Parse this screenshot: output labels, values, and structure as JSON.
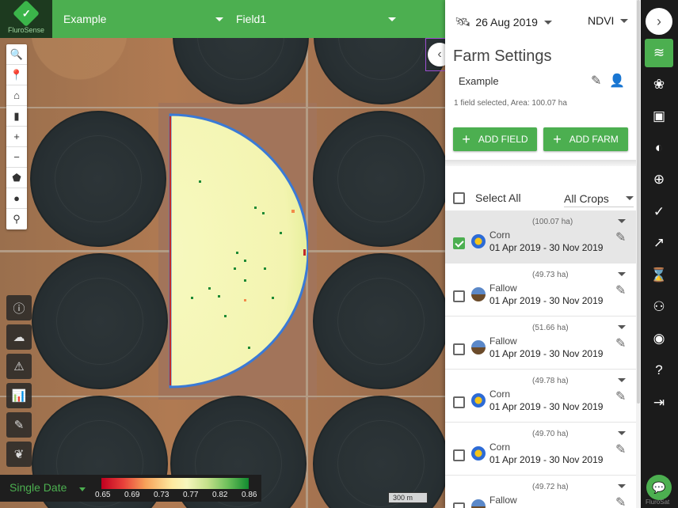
{
  "app": {
    "logo_text": "FluroSense"
  },
  "topbar": {
    "farm_select": "Example",
    "field_select": "Field1"
  },
  "map_tools": [
    {
      "name": "search-icon",
      "glyph": "🔍"
    },
    {
      "name": "pin-icon",
      "glyph": "📍"
    },
    {
      "name": "home-icon",
      "glyph": "⌂"
    },
    {
      "name": "ruler-icon",
      "glyph": "▮"
    },
    {
      "name": "zoom-in-icon",
      "glyph": "+"
    },
    {
      "name": "zoom-out-icon",
      "glyph": "−"
    },
    {
      "name": "polygon-icon",
      "glyph": "⬟"
    },
    {
      "name": "circle-icon",
      "glyph": "●"
    },
    {
      "name": "marker-icon",
      "glyph": "⚲"
    }
  ],
  "left_tools": [
    {
      "name": "info-icon",
      "glyph": "ⓘ"
    },
    {
      "name": "weather-icon",
      "glyph": "☁"
    },
    {
      "name": "warning-icon",
      "glyph": "⚠"
    },
    {
      "name": "chart-icon",
      "glyph": "📊"
    },
    {
      "name": "draw-icon",
      "glyph": "✎"
    },
    {
      "name": "leaf-icon",
      "glyph": "❦"
    }
  ],
  "legend": {
    "mode": "Single Date",
    "ticks": [
      "0.65",
      "0.69",
      "0.73",
      "0.77",
      "0.82",
      "0.86"
    ]
  },
  "scale_label": "300 m",
  "panel": {
    "date": "26 Aug 2019",
    "layer": "NDVI",
    "title": "Farm Settings",
    "farm_name": "Example",
    "selection_info": "1 field selected, Area: 100.07 ha",
    "add_field_label": "ADD FIELD",
    "add_farm_label": "ADD FARM",
    "select_all_label": "Select All",
    "crops_filter": "All Crops",
    "fields": [
      {
        "area": "(100.07 ha)",
        "crop": "Corn",
        "dates": "01 Apr 2019 - 30 Nov 2019",
        "selected": true,
        "crop_type": "corn"
      },
      {
        "area": "(49.73 ha)",
        "crop": "Fallow",
        "dates": "01 Apr 2019 - 30 Nov 2019",
        "selected": false,
        "crop_type": "fallow"
      },
      {
        "area": "(51.66 ha)",
        "crop": "Fallow",
        "dates": "01 Apr 2019 - 30 Nov 2019",
        "selected": false,
        "crop_type": "fallow"
      },
      {
        "area": "(49.78 ha)",
        "crop": "Corn",
        "dates": "01 Apr 2019 - 30 Nov 2019",
        "selected": false,
        "crop_type": "corn"
      },
      {
        "area": "(49.70 ha)",
        "crop": "Corn",
        "dates": "01 Apr 2019 - 30 Nov 2019",
        "selected": false,
        "crop_type": "corn"
      },
      {
        "area": "(49.72 ha)",
        "crop": "Fallow",
        "dates": "",
        "selected": false,
        "crop_type": "fallow"
      }
    ]
  },
  "rail": {
    "icons": [
      {
        "name": "map-layers-icon",
        "glyph": "≋",
        "active": true
      },
      {
        "name": "crop-icon",
        "glyph": "❀"
      },
      {
        "name": "images-icon",
        "glyph": "▣"
      },
      {
        "name": "half-circle-icon",
        "glyph": "◐"
      },
      {
        "name": "zones-icon",
        "glyph": "⊕"
      },
      {
        "name": "check-circle-icon",
        "glyph": "✓"
      },
      {
        "name": "trend-icon",
        "glyph": "↗"
      },
      {
        "name": "hourglass-icon",
        "glyph": "⌛"
      },
      {
        "name": "group-icon",
        "glyph": "⚇"
      },
      {
        "name": "account-icon",
        "glyph": "◉"
      },
      {
        "name": "help-icon",
        "glyph": "?"
      },
      {
        "name": "logout-icon",
        "glyph": "⇥"
      }
    ],
    "attribution": "FluroSat"
  },
  "colors": {
    "accent": "#4caf50",
    "dark": "#1b1b1b"
  }
}
